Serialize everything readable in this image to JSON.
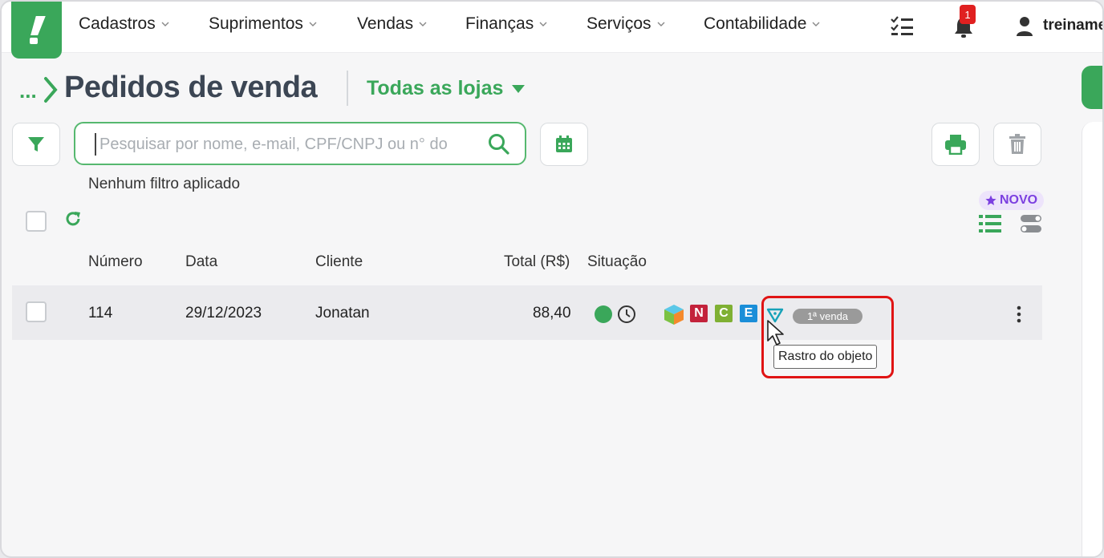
{
  "nav": {
    "items": [
      "Cadastros",
      "Suprimentos",
      "Vendas",
      "Finanças",
      "Serviços",
      "Contabilidade"
    ],
    "notification_count": "1",
    "user_name": "treiname"
  },
  "header": {
    "breadcrumb_dots": "...",
    "title": "Pedidos de venda",
    "store_select": "Todas as lojas"
  },
  "search": {
    "placeholder": "Pesquisar por nome, e-mail, CPF/CNPJ ou n° do",
    "value": ""
  },
  "filter_status": "Nenhum filtro aplicado",
  "novo_badge": "NOVO",
  "table": {
    "headers": [
      "Número",
      "Data",
      "Cliente",
      "Total (R$)",
      "Situação"
    ],
    "rows": [
      {
        "numero": "114",
        "data": "29/12/2023",
        "cliente": "Jonatan",
        "total": "88,40",
        "tags": [
          "N",
          "C",
          "E"
        ],
        "pill": "1ª venda"
      }
    ]
  },
  "tooltip": "Rastro do objeto",
  "colors": {
    "brand_green": "#3aa75a",
    "tag_n": "#c3223b",
    "tag_c": "#7fb033",
    "tag_e": "#1a8ed8",
    "status_dot": "#3aa75a",
    "highlight": "#e01414"
  }
}
